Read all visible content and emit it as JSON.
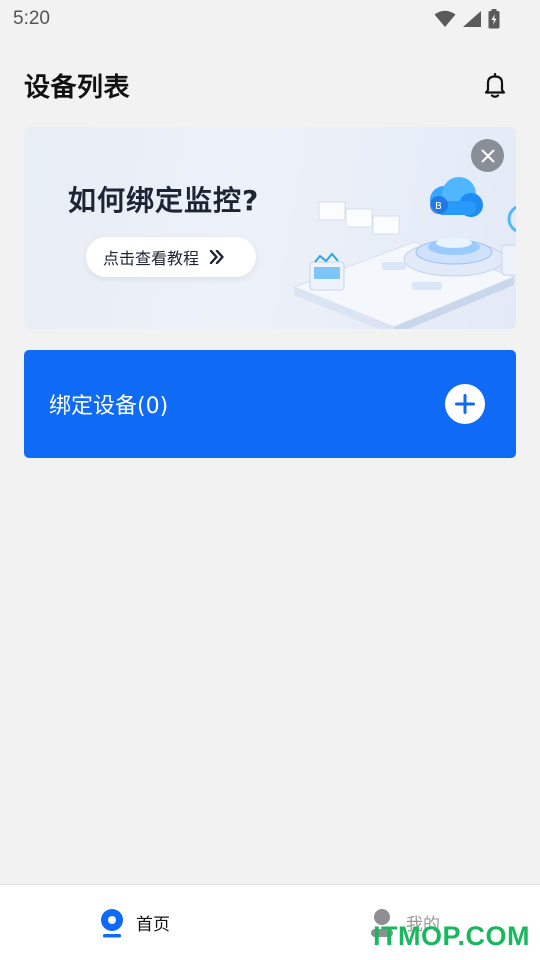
{
  "status_bar": {
    "time": "5:20",
    "icons": [
      "wifi-icon",
      "signal-icon",
      "battery-charging-icon"
    ]
  },
  "header": {
    "title": "设备列表",
    "bell_icon": "bell-icon"
  },
  "banner": {
    "title": "如何绑定监控?",
    "button_label": "点击查看教程",
    "button_icon": "double-chevron-right-icon",
    "close_icon": "close-icon"
  },
  "bind_card": {
    "label": "绑定设备(0)",
    "icon": "plus-icon",
    "color": "#0f6af5"
  },
  "bottom_nav": {
    "items": [
      {
        "label": "首页",
        "icon": "home-dot-icon",
        "active": true
      },
      {
        "label": "我的",
        "icon": "user-icon",
        "active": false
      }
    ],
    "active_color": "#0f6af5"
  },
  "watermark": "ITMOP.COM"
}
